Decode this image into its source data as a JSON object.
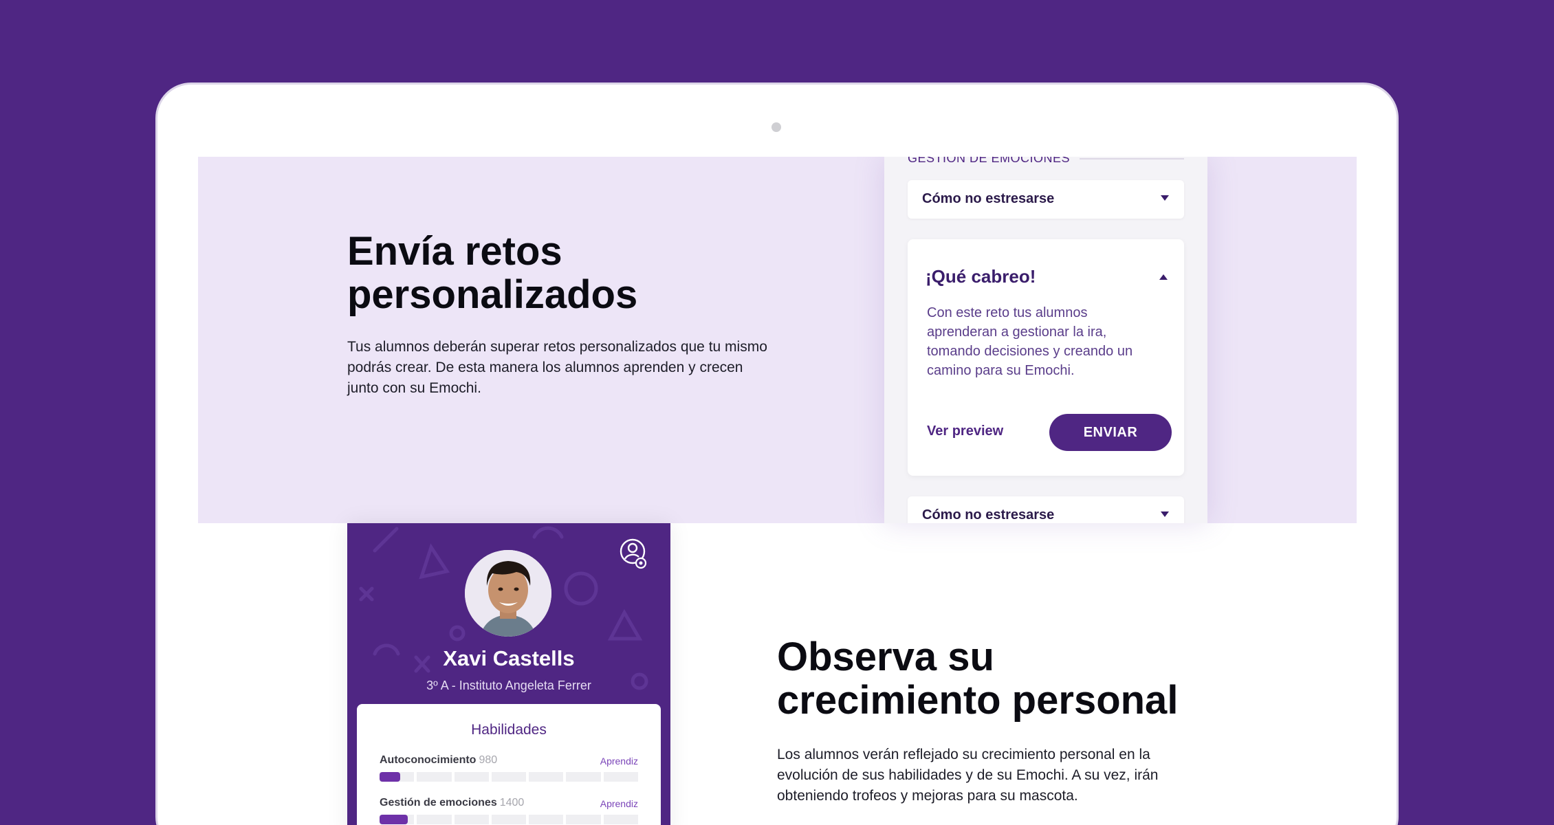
{
  "section_retos": {
    "title": "Envía retos personalizados",
    "description": "Tus alumnos deberán superar retos personalizados que tu mismo podrás crear. De esta manera los alumnos aprenden y crecen junto con su Emochi."
  },
  "phone": {
    "category": "GESTIÓN DE EMOCIONES",
    "accordion_top": {
      "label": "Cómo no estresarse",
      "icon": "chevron-down-icon"
    },
    "expanded_card": {
      "title": "¡Qué cabreo!",
      "icon": "chevron-up-icon",
      "description": "Con este reto tus alumnos aprenderan a gestionar la ira, tomando decisiones y creando un camino para su Emochi.",
      "preview_label": "Ver preview",
      "send_label": "ENVIAR"
    },
    "accordion_bottom": {
      "label": "Cómo no estresarse",
      "icon": "chevron-down-icon"
    }
  },
  "profile": {
    "name": "Xavi Castells",
    "subtitle": "3º A - Instituto Angeleta Ferrer",
    "settings_icon": "user-settings-icon",
    "skills_title": "Habilidades",
    "skills": [
      {
        "label": "Autoconocimiento",
        "value": "980",
        "level": "Aprendiz",
        "progress": 0.08
      },
      {
        "label": "Gestión de emociones",
        "value": "1400",
        "level": "Aprendiz",
        "progress": 0.11
      }
    ]
  },
  "section_crecimiento": {
    "title": "Observa su crecimiento personal",
    "description": "Los alumnos verán reflejado su crecimiento personal en la evolución de sus habilidades y de su Emochi. A su vez, irán obteniendo trofeos y mejoras para su mascota."
  },
  "colors": {
    "brand": "#4f2683",
    "section_bg": "#ede5f7",
    "accent": "#6e31a8"
  }
}
